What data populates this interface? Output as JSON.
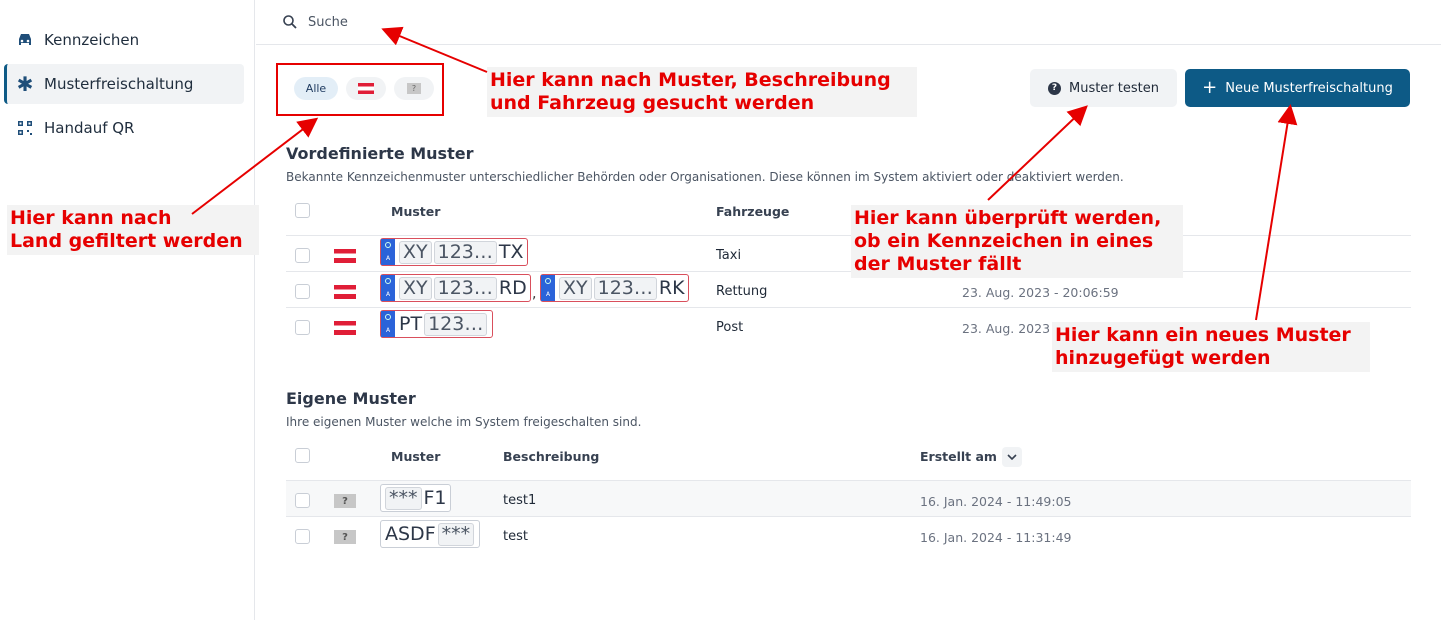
{
  "sidebar": {
    "items": [
      {
        "label": "Kennzeichen",
        "icon": "car-icon"
      },
      {
        "label": "Musterfreischaltung",
        "icon": "asterisk-icon"
      },
      {
        "label": "Handauf QR",
        "icon": "qr-code-icon"
      }
    ]
  },
  "search": {
    "placeholder": "Suche"
  },
  "filters": {
    "alle": "Alle",
    "unknown": "?"
  },
  "buttons": {
    "test": "Muster testen",
    "new": "Neue Musterfreischaltung"
  },
  "predefined": {
    "title": "Vordefinierte Muster",
    "subtitle": "Bekannte Kennzeichenmuster unterschiedlicher Behörden oder Organisationen. Diese können im System aktiviert oder deaktiviert werden.",
    "columns": {
      "muster": "Muster",
      "fahrzeuge": "Fahrzeuge"
    },
    "rows": [
      {
        "plates": [
          {
            "region": "XY",
            "num": "123…",
            "suffix": "TX"
          }
        ],
        "fahrzeug": "Taxi",
        "date": ""
      },
      {
        "plates": [
          {
            "region": "XY",
            "num": "123…",
            "suffix": "RD"
          },
          {
            "region": "XY",
            "num": "123…",
            "suffix": "RK"
          }
        ],
        "fahrzeug": "Rettung",
        "date": "23. Aug. 2023 - 20:06:59"
      },
      {
        "plates": [
          {
            "prefix": "PT",
            "num": "123…"
          }
        ],
        "fahrzeug": "Post",
        "date": "23. Aug. 2023"
      }
    ],
    "eu_letter": "A",
    "separator": ","
  },
  "own": {
    "title": "Eigene Muster",
    "subtitle": "Ihre eigenen Muster welche im System freigeschalten sind.",
    "columns": {
      "muster": "Muster",
      "beschreibung": "Beschreibung",
      "erstellt": "Erstellt am"
    },
    "rows": [
      {
        "box": "***",
        "text": "F1",
        "beschreibung": "test1",
        "date": "16. Jan. 2024 - 11:49:05"
      },
      {
        "text": "ASDF",
        "box": "***",
        "beschreibung": "test",
        "date": "16. Jan. 2024 - 11:31:49"
      }
    ],
    "unknown_flag": "?"
  },
  "annotations": {
    "search": "Hier kann nach Muster, Beschreibung\nund Fahrzeug gesucht werden",
    "country": "Hier kann nach\nLand gefiltert werden",
    "test": "Hier kann überprüft werden,\nob ein Kennzeichen in eines\nder Muster fällt",
    "new": "Hier kann ein neues Muster\nhinzugefügt werden"
  },
  "colors": {
    "primary": "#0d5a86",
    "annotation": "#e60000",
    "flag_red": "#e01e37",
    "eu_blue": "#2b63d9"
  }
}
